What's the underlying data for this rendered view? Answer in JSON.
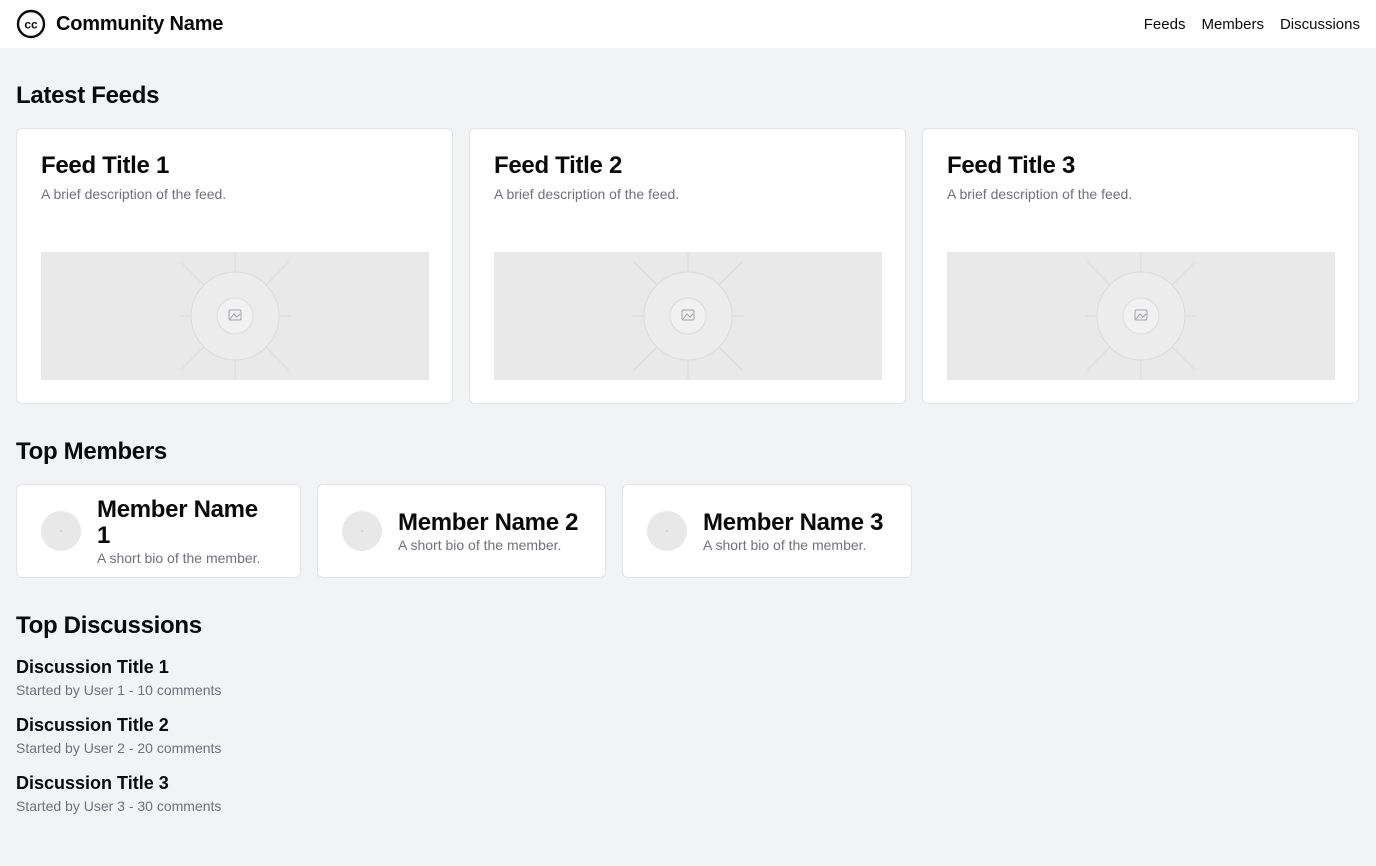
{
  "header": {
    "brand_name": "Community Name",
    "logo_text": "cc",
    "nav": [
      "Feeds",
      "Members",
      "Discussions"
    ]
  },
  "feeds": {
    "title": "Latest Feeds",
    "items": [
      {
        "title": "Feed Title 1",
        "description": "A brief description of the feed."
      },
      {
        "title": "Feed Title 2",
        "description": "A brief description of the feed."
      },
      {
        "title": "Feed Title 3",
        "description": "A brief description of the feed."
      }
    ]
  },
  "members": {
    "title": "Top Members",
    "items": [
      {
        "name": "Member Name 1",
        "bio": "A short bio of the member."
      },
      {
        "name": "Member Name 2",
        "bio": "A short bio of the member."
      },
      {
        "name": "Member Name 3",
        "bio": "A short bio of the member."
      }
    ]
  },
  "discussions": {
    "title": "Top Discussions",
    "items": [
      {
        "title": "Discussion Title 1",
        "meta": "Started by User 1 - 10 comments"
      },
      {
        "title": "Discussion Title 2",
        "meta": "Started by User 2 - 20 comments"
      },
      {
        "title": "Discussion Title 3",
        "meta": "Started by User 3 - 30 comments"
      }
    ]
  },
  "colors": {
    "page_background": "#f2f3f5",
    "card_background": "#ffffff",
    "muted_text": "#71717a",
    "placeholder": "#e9e9ea"
  }
}
